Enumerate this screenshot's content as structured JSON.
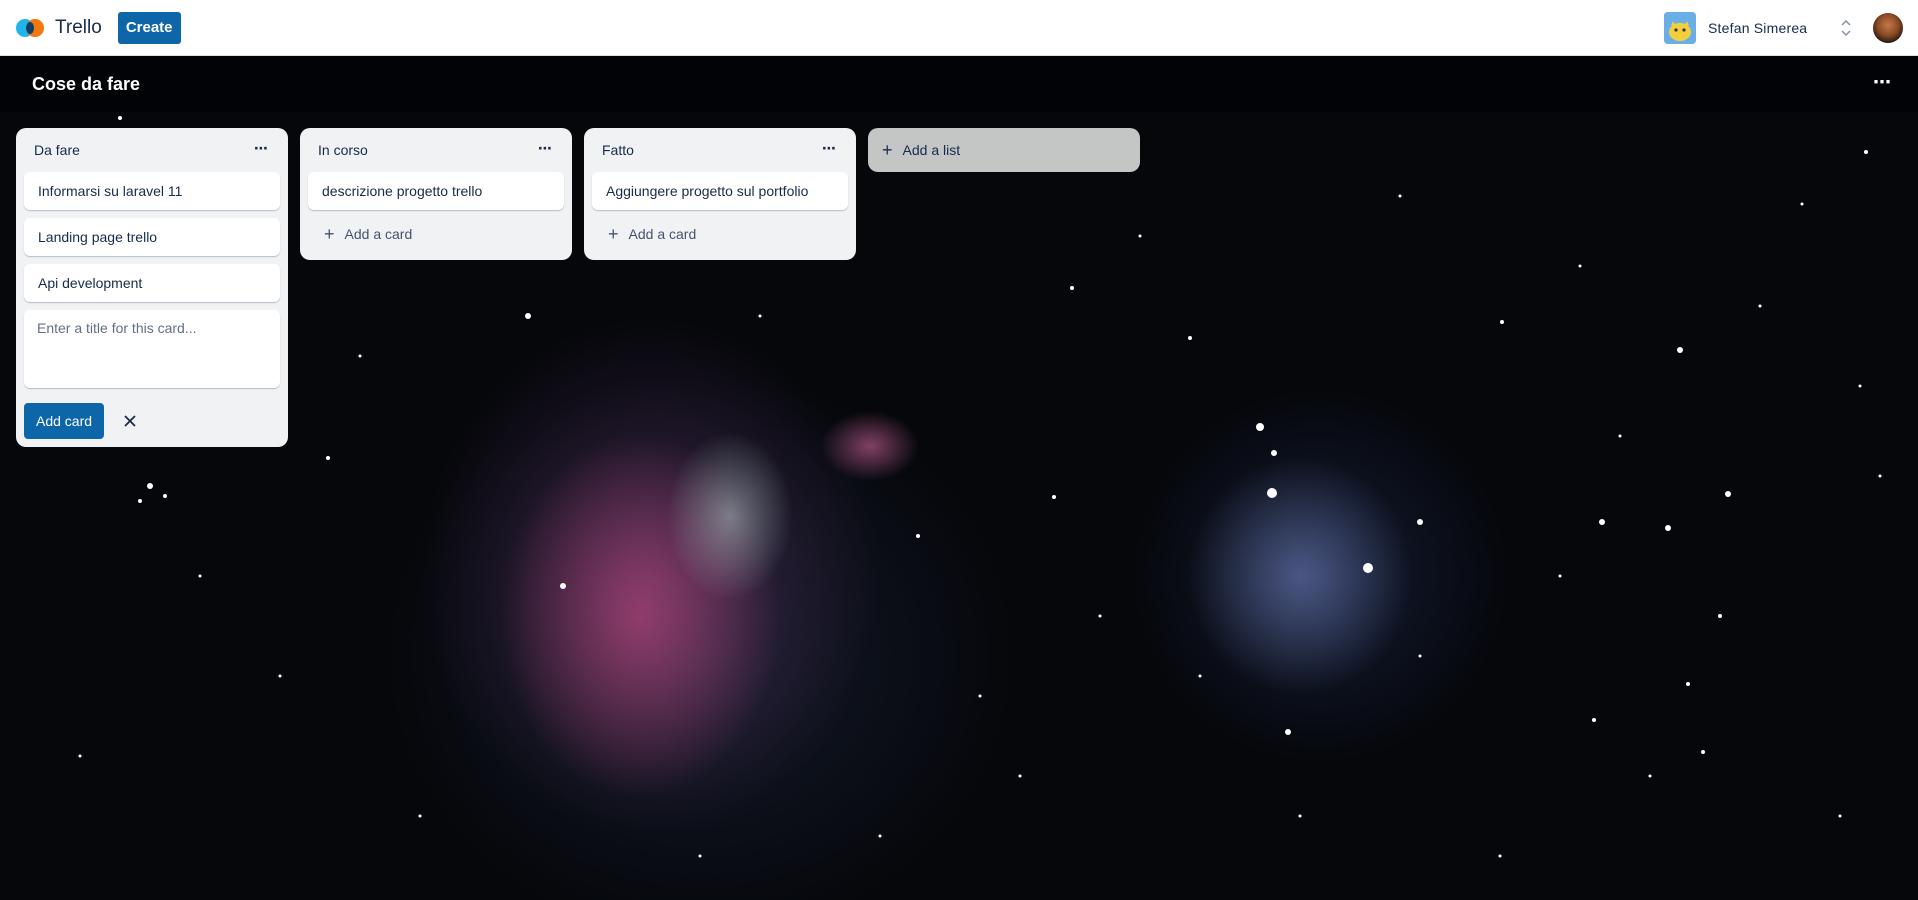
{
  "app": {
    "name": "Trello",
    "create_label": "Create"
  },
  "user": {
    "name": "Stefan Simerea"
  },
  "board": {
    "title": "Cose da fare",
    "lists": [
      {
        "title": "Da fare",
        "cards": [
          "Informarsi su laravel 11",
          "Landing page trello",
          "Api development"
        ],
        "composer_placeholder": "Enter a title for this card...",
        "add_card_button": "Add card"
      },
      {
        "title": "In corso",
        "cards": [
          "descrizione progetto trello"
        ],
        "add_card_label": "Add a card"
      },
      {
        "title": "Fatto",
        "cards": [
          "Aggiungere progetto sul portfolio"
        ],
        "add_card_label": "Add a card"
      }
    ],
    "add_list_label": "Add a list"
  },
  "colors": {
    "accent": "#0c66a8",
    "list_bg": "#f1f2f4",
    "text": "#172b4d"
  },
  "icons": [
    "trello-logo-icon",
    "switch-account-icon",
    "profile-avatar",
    "board-menu-icon",
    "list-menu-icon",
    "plus-icon",
    "close-icon"
  ]
}
